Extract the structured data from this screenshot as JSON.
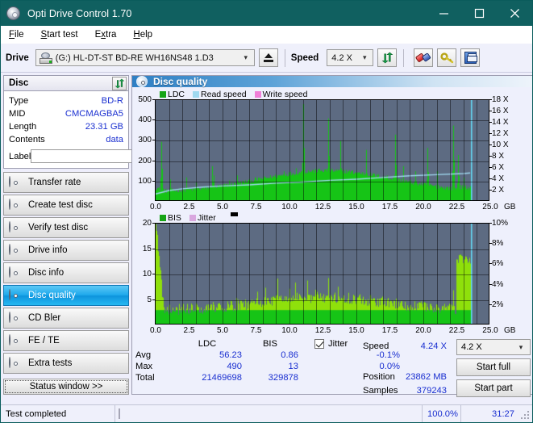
{
  "window": {
    "title": "Opti Drive Control 1.70",
    "icon": "disc-icon",
    "minimize": "minimize-icon",
    "maximize": "maximize-icon",
    "close": "close-icon"
  },
  "menu": {
    "items": [
      {
        "label": "File",
        "accel": "F"
      },
      {
        "label": "Start test",
        "accel": "S"
      },
      {
        "label": "Extra",
        "accel": "x"
      },
      {
        "label": "Help",
        "accel": "H"
      }
    ]
  },
  "toolbar": {
    "drive_label": "Drive",
    "drive_value": "(G:)  HL-DT-ST BD-RE  WH16NS48 1.D3",
    "eject_title": "eject-icon",
    "speed_label": "Speed",
    "speed_value": "4.2 X",
    "refresh_title": "refresh-icon",
    "erase_title": "eraser-icon",
    "key_title": "key-icon",
    "save_title": "save-icon"
  },
  "disc_panel": {
    "title": "Disc",
    "refresh_title": "refresh-icon",
    "rows": [
      {
        "key": "Type",
        "value": "BD-R"
      },
      {
        "key": "MID",
        "value": "CMCMAGBA5"
      },
      {
        "key": "Length",
        "value": "23.31 GB"
      },
      {
        "key": "Contents",
        "value": "data"
      }
    ],
    "label_key": "Label",
    "label_value": "",
    "label_placeholder": ""
  },
  "sidebar": {
    "items": [
      {
        "label": "Transfer rate",
        "selected": false
      },
      {
        "label": "Create test disc",
        "selected": false
      },
      {
        "label": "Verify test disc",
        "selected": false
      },
      {
        "label": "Drive info",
        "selected": false
      },
      {
        "label": "Disc info",
        "selected": false
      },
      {
        "label": "Disc quality",
        "selected": true
      },
      {
        "label": "CD Bler",
        "selected": false
      },
      {
        "label": "FE / TE",
        "selected": false
      },
      {
        "label": "Extra tests",
        "selected": false
      }
    ],
    "status_button": "Status window >>"
  },
  "main": {
    "title": "Disc quality",
    "colors": {
      "ldc": "#16c416",
      "read_speed": "#9fd8ef",
      "write_speed": "#f07fd8",
      "bis": "#16c416",
      "jitter": "#d9a8df",
      "plot_bg": "#5d6b82",
      "accent": "#1a2fd0"
    }
  },
  "chart_data": [
    {
      "type": "bar",
      "name": "ldc-chart",
      "title": "",
      "legend": [
        {
          "label": "LDC",
          "color": "#16c416"
        },
        {
          "label": "Read speed",
          "color": "#9fd8ef"
        },
        {
          "label": "Write speed",
          "color": "#f07fd8"
        }
      ],
      "legend_position": "top-left",
      "grid": true,
      "xlabel": "GB",
      "xlim": [
        0.0,
        25.0
      ],
      "xticks": [
        "0.0",
        "2.5",
        "5.0",
        "7.5",
        "10.0",
        "12.5",
        "15.0",
        "17.5",
        "20.0",
        "22.5",
        "25.0"
      ],
      "x_unit": "GB",
      "ylabel_left": "LDC",
      "ylim_left": [
        0,
        500
      ],
      "yticks_left": [
        "100",
        "200",
        "300",
        "400",
        "500"
      ],
      "ylabel_right": "Speed",
      "ylim_right": [
        0,
        18
      ],
      "yticks_right": [
        "2 X",
        "4 X",
        "6 X",
        "8 X",
        "10 X",
        "12 X",
        "14 X",
        "16 X",
        "18 X"
      ],
      "series": [
        {
          "name": "LDC",
          "color": "#16c416",
          "kind": "bars",
          "baseline": 45,
          "bulge_center": 12.8,
          "bulge_width": 7.0,
          "bulge_height": 105,
          "noise": 22,
          "spikes": [
            [
              0.45,
              295
            ],
            [
              0.5,
              120
            ],
            [
              1.1,
              110
            ],
            [
              2.3,
              120
            ],
            [
              3.0,
              95
            ],
            [
              4.2,
              175
            ],
            [
              4.35,
              130
            ],
            [
              5.5,
              105
            ],
            [
              6.1,
              130
            ],
            [
              7.4,
              120
            ],
            [
              9.6,
              150
            ],
            [
              10.5,
              165
            ],
            [
              11.0,
              480
            ],
            [
              12.1,
              160
            ],
            [
              12.9,
              410
            ],
            [
              13.8,
              300
            ],
            [
              14.9,
              140
            ],
            [
              15.7,
              255
            ],
            [
              16.6,
              135
            ],
            [
              17.3,
              130
            ],
            [
              17.9,
              330
            ],
            [
              18.5,
              175
            ],
            [
              19.4,
              150
            ],
            [
              20.3,
              265
            ],
            [
              21.0,
              150
            ],
            [
              22.2,
              375
            ],
            [
              22.6,
              230
            ],
            [
              23.0,
              120
            ]
          ]
        },
        {
          "name": "Read speed",
          "color": "#9fd8ef",
          "kind": "line",
          "points": [
            [
              0.0,
              1.4
            ],
            [
              1.0,
              2.0
            ],
            [
              2.0,
              2.3
            ],
            [
              3.5,
              2.6
            ],
            [
              5.0,
              2.8
            ],
            [
              7.0,
              3.0
            ],
            [
              9.0,
              3.3
            ],
            [
              11.0,
              3.5
            ],
            [
              13.0,
              3.8
            ],
            [
              15.0,
              4.0
            ],
            [
              17.0,
              4.3
            ],
            [
              19.0,
              4.6
            ],
            [
              21.0,
              4.8
            ],
            [
              23.0,
              5.0
            ],
            [
              23.5,
              5.1
            ]
          ]
        },
        {
          "name": "Write speed",
          "color": "#f07fd8",
          "kind": "line",
          "points": []
        }
      ],
      "cursor_x": 23.6,
      "cursor_color": "#63d8f5"
    },
    {
      "type": "bar",
      "name": "bis-chart",
      "title": "",
      "legend": [
        {
          "label": "BIS",
          "color": "#16c416"
        },
        {
          "label": "Jitter",
          "color": "#d9a8df"
        }
      ],
      "legend_position": "top-left",
      "grid": true,
      "xlabel": "GB",
      "xlim": [
        0.0,
        25.0
      ],
      "xticks": [
        "0.0",
        "2.5",
        "5.0",
        "7.5",
        "10.0",
        "12.5",
        "15.0",
        "17.5",
        "20.0",
        "22.5",
        "25.0"
      ],
      "x_unit": "GB",
      "ylabel_left": "BIS",
      "ylim_left": [
        0,
        20
      ],
      "yticks_left": [
        "5",
        "10",
        "15",
        "20"
      ],
      "ylabel_right": "Jitter",
      "ylim_right": [
        0,
        10
      ],
      "yticks_right": [
        "2%",
        "4%",
        "6%",
        "8%",
        "10%"
      ],
      "series": [
        {
          "name": "BIS",
          "color": "#16c416",
          "kind": "bars",
          "baseline": 2.6,
          "bulge_center": 12.5,
          "bulge_width": 6.5,
          "bulge_height": 2.6,
          "noise": 2.2,
          "spikes": [
            [
              9.1,
              9.2
            ],
            [
              10.4,
              8.4
            ],
            [
              11.3,
              8.8
            ],
            [
              12.9,
              9.3
            ],
            [
              8.2,
              7.4
            ],
            [
              13.6,
              7.6
            ],
            [
              10.0,
              7.2
            ],
            [
              11.9,
              7.0
            ],
            [
              7.6,
              6.6
            ],
            [
              14.4,
              6.4
            ],
            [
              22.2,
              6.9
            ],
            [
              6.0,
              5.4
            ],
            [
              16.8,
              5.2
            ],
            [
              4.3,
              4.6
            ],
            [
              19.5,
              4.3
            ]
          ]
        },
        {
          "name": "Jitter",
          "color": "#d9a8df",
          "kind": "line",
          "points": []
        }
      ],
      "cursor_x": 23.6,
      "cursor_color": "#63d8f5"
    }
  ],
  "stats": {
    "headers": [
      "",
      "LDC",
      "BIS"
    ],
    "rows": [
      {
        "key": "Avg",
        "ldc": "56.23",
        "bis": "0.86",
        "jitter": "-0.1%"
      },
      {
        "key": "Max",
        "ldc": "490",
        "bis": "13",
        "jitter": "0.0%"
      },
      {
        "key": "Total",
        "ldc": "21469698",
        "bis": "329878",
        "jitter": ""
      }
    ],
    "jitter_label": "Jitter",
    "jitter_checked": true
  },
  "controls": {
    "speed_label": "Speed",
    "speed_value": "4.24 X",
    "position_label": "Position",
    "position_value": "23862 MB",
    "samples_label": "Samples",
    "samples_value": "379243",
    "speed_select": "4.2 X",
    "start_full": "Start full",
    "start_part": "Start part"
  },
  "statusbar": {
    "message": "Test completed",
    "progress_percent": 100.0,
    "progress_text": "100.0%",
    "elapsed": "31:27"
  }
}
